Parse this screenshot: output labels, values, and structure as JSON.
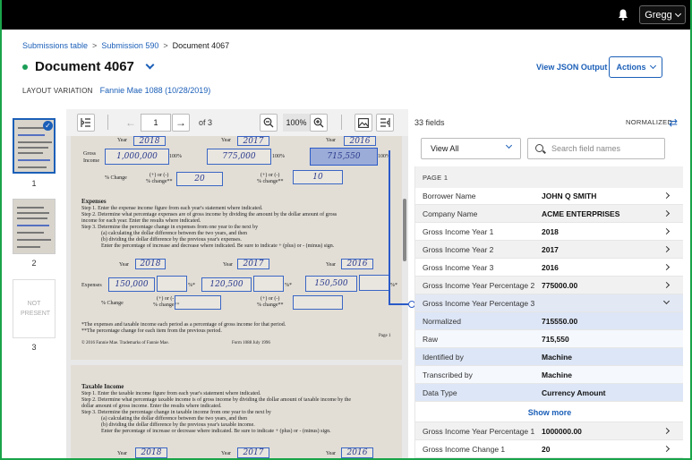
{
  "topbar": {
    "user": "Gregg"
  },
  "breadcrumb": {
    "items": [
      "Submissions table",
      "Submission 590",
      "Document 4067"
    ]
  },
  "document": {
    "title": "Document 4067",
    "layout_variation_label": "LAYOUT VARIATION",
    "layout_variation_value": "Fannie Mae 1088 (10/28/2019)",
    "view_json": "View JSON Output",
    "actions": "Actions"
  },
  "thumbnails": [
    {
      "num": "1"
    },
    {
      "num": "2"
    },
    {
      "num": "3",
      "label": "NOT PRESENT"
    }
  ],
  "viewer": {
    "page": "1",
    "of": "of 3",
    "zoom": "100%",
    "page1": {
      "year_label": "Year",
      "years_hw": [
        "2018",
        "2017",
        "2016"
      ],
      "gross_income": "Gross Income",
      "gross_hw": [
        "1,000,000",
        "775,000",
        "715,550"
      ],
      "pct_100": "100%",
      "pct_change": "% Change",
      "pct_change_note": "(+) or (-)",
      "pct_change_star": "% change**",
      "pct_hw": [
        "20",
        "10"
      ],
      "expenses_title": "Expenses",
      "steps": [
        "Step 1. Enter the expense income figure from each year's statement where indicated.",
        "Step 2. Determine what percentage expenses are of gross income by dividing the amount by the dollar amount of gross",
        "income for each year. Enter the results where indicated.",
        "Step 3. Determine the percentage change in expenses from one year to the next by",
        "(a) calculating the dollar difference between the two years, and then",
        "(b) dividing the dollar difference by the previous year's expenses.",
        "Enter the percentage of increase and decrease where indicated. Be sure to indicate + (plus) or - (minus) sign."
      ],
      "exp_years_hw": [
        "2018",
        "2017",
        "2016"
      ],
      "expenses_label": "Expenses",
      "exp_hw": [
        "150,000",
        "120,500",
        "150,500"
      ],
      "pct_star": "%*",
      "footnote1": "*The expenses and taxable income each period as a percentage of gross income for that period.",
      "footnote2": "**The percentage change for each item from the previous period.",
      "copyright": "© 2016 Fannie Mae. Trademarks of Fannie Mae.",
      "form_no": "Form 1088   July 1996",
      "page_label": "Page 1"
    },
    "page2": {
      "title": "Taxable Income",
      "steps": [
        "Step 1. Enter the taxable income figure from each year's statement where indicated.",
        "Step 2. Determine what percentage taxable income is of gross income by dividing the dollar amount of taxable income by the",
        "dollar amount of gross income. Enter the results where indicated.",
        "Step 3. Determine the percentage change in taxable income from one year to the next by",
        "(a) calculating the dollar difference between the two years, and then",
        "(b) dividing the dollar difference by the previous year's taxable income.",
        "Enter the percentage of increase or decrease where indicated. Be sure to indicate + (plus) or - (minus) sign."
      ],
      "year_label": "Year",
      "years_hw": [
        "2018",
        "2017",
        "2016"
      ]
    }
  },
  "panel": {
    "fields_count": "33 fields",
    "normalized": "NORMALIZED",
    "view_select": "View All",
    "search_placeholder": "Search field names",
    "page_label": "PAGE 1",
    "rows": [
      {
        "name": "Borrower Name",
        "value": "JOHN Q SMITH"
      },
      {
        "name": "Company Name",
        "value": "ACME ENTERPRISES"
      },
      {
        "name": "Gross Income Year 1",
        "value": "2018"
      },
      {
        "name": "Gross Income Year 2",
        "value": "2017"
      },
      {
        "name": "Gross Income Year 3",
        "value": "2016"
      },
      {
        "name": "Gross Income Year Percentage 2",
        "value": "775000.00"
      },
      {
        "name": "Gross Income Year Percentage 3",
        "value": ""
      }
    ],
    "details": [
      {
        "name": "Normalized",
        "value": "715550.00"
      },
      {
        "name": "Raw",
        "value": "715,550"
      },
      {
        "name": "Identified by",
        "value": "Machine"
      },
      {
        "name": "Transcribed by",
        "value": "Machine"
      },
      {
        "name": "Data Type",
        "value": "Currency Amount"
      }
    ],
    "show_more": "Show more",
    "rows_after": [
      {
        "name": "Gross Income Year Percentage 1",
        "value": "1000000.00"
      },
      {
        "name": "Gross Income Change 1",
        "value": "20"
      }
    ]
  }
}
